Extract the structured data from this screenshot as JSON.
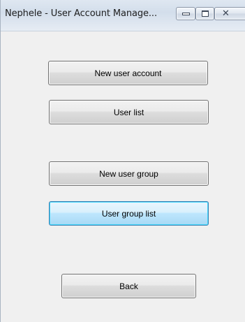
{
  "window": {
    "title": "Nephele - User Account Manage..."
  },
  "caption_buttons": {
    "minimize": "minimize-icon",
    "maximize": "maximize-icon",
    "close_glyph": "✕"
  },
  "menu": {
    "new_user_account": "New user account",
    "user_list": "User list",
    "new_user_group": "New user group",
    "user_group_list": "User group list",
    "back": "Back"
  }
}
